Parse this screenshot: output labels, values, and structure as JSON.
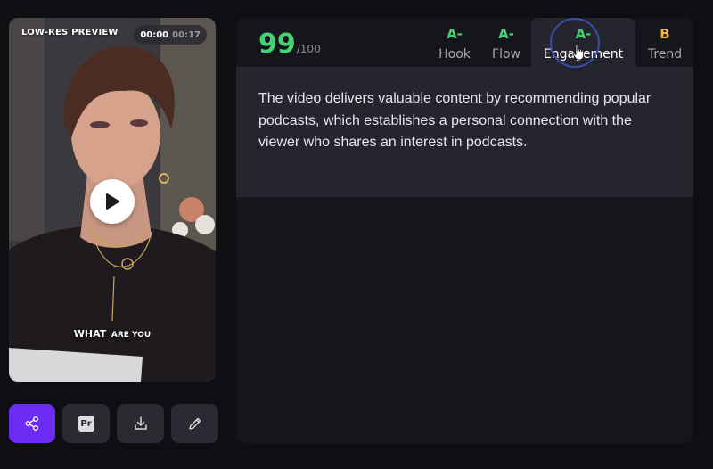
{
  "preview": {
    "badge": "LOW-RES PREVIEW",
    "current_time": "00:00",
    "total_time": "00:17",
    "caption_big": "WHAT",
    "caption_small": "ARE YOU"
  },
  "actions": {
    "premiere_label": "Pr"
  },
  "score": {
    "value": "99",
    "out_of": "/100",
    "color": "#46d175"
  },
  "tabs": [
    {
      "grade": "A-",
      "label": "Hook",
      "grade_color": "#46d175"
    },
    {
      "grade": "A-",
      "label": "Flow",
      "grade_color": "#46d175"
    },
    {
      "grade": "A-",
      "label": "Engagement",
      "grade_color": "#46d175",
      "active": true
    },
    {
      "grade": "B",
      "label": "Trend",
      "grade_color": "#f2b53a"
    }
  ],
  "details": {
    "text": "The video delivers valuable content by recommending popular podcasts, which establishes a personal connection with the viewer who shares an interest in podcasts."
  },
  "colors": {
    "accent": "#6d2cf5",
    "background": "#0e0e13",
    "panel": "#15151c"
  }
}
